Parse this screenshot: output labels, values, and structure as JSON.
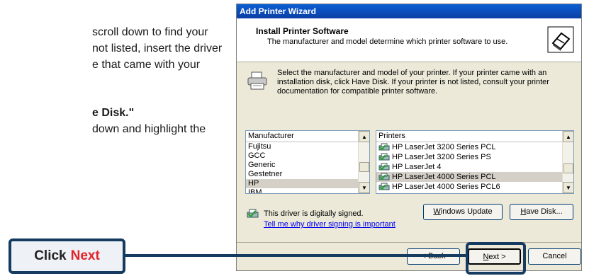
{
  "manual": {
    "line1": "scroll down to find your",
    "line2": "not listed, insert the driver",
    "line3": "e  that  came  with  your",
    "line4": "e Disk.\"",
    "line5": "down  and  highlight  the"
  },
  "dialog": {
    "title": "Add Printer Wizard",
    "header_title": "Install Printer Software",
    "header_subtitle": "The manufacturer and model determine which printer software to use.",
    "intro": "Select the manufacturer and model of your printer. If your printer came with an installation disk, click Have Disk. If your printer is not listed, consult your printer documentation for compatible printer software.",
    "manufacturer_header": "Manufacturer",
    "manufacturers": [
      "Fujitsu",
      "GCC",
      "Generic",
      "Gestetner",
      "HP",
      "IBM"
    ],
    "selected_manufacturer": "HP",
    "printers_header": "Printers",
    "printers": [
      "HP LaserJet 3200 Series PCL",
      "HP LaserJet 3200 Series PS",
      "HP LaserJet 4",
      "HP LaserJet 4000 Series PCL",
      "HP LaserJet 4000 Series PCL6"
    ],
    "selected_printer": "HP LaserJet 4000 Series PCL",
    "signed_text": "This driver is digitally signed.",
    "signed_link": "Tell me why driver signing is important",
    "windows_update_pre": "",
    "windows_update_acc": "W",
    "windows_update_post": "indows Update",
    "have_disk_acc": "H",
    "have_disk_post": "ave Disk...",
    "back_label": "< Back",
    "next_acc": "N",
    "next_post": "ext >",
    "cancel_label": "Cancel"
  },
  "callout": {
    "prefix": "Click",
    "emphasis": "Next",
    "accent_color": "#e0242a",
    "frame_color": "#153b61"
  }
}
